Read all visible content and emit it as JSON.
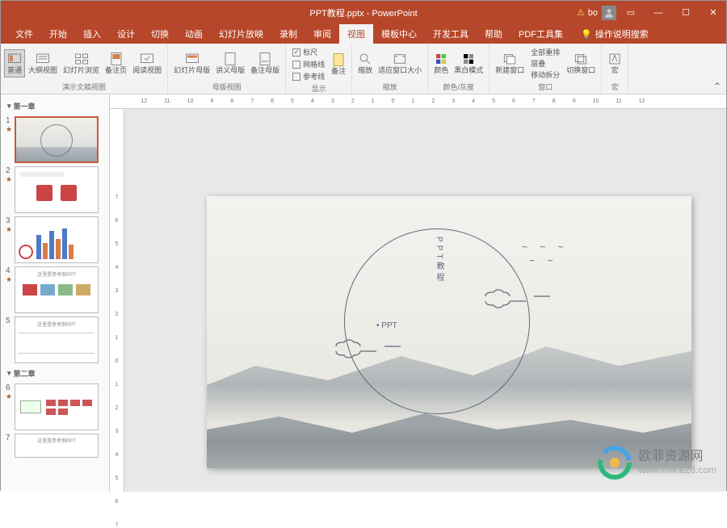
{
  "titlebar": {
    "title": "PPT教程.pptx - PowerPoint",
    "warn_icon": "⚠",
    "user": "bo"
  },
  "menu": {
    "items": [
      "文件",
      "开始",
      "插入",
      "设计",
      "切换",
      "动画",
      "幻灯片放映",
      "录制",
      "审阅",
      "视图",
      "模板中心",
      "开发工具",
      "帮助",
      "PDF工具集"
    ],
    "active_index": 9,
    "tell_me": "操作说明搜索"
  },
  "ribbon": {
    "presentation_views": {
      "label": "演示文稿视图",
      "normal": "普通",
      "outline": "大纲视图",
      "sorter": "幻灯片浏览",
      "notes_page": "备注页",
      "reading": "阅读视图"
    },
    "master_views": {
      "label": "母版视图",
      "slide_master": "幻灯片母版",
      "handout_master": "讲义母版",
      "notes_master": "备注母版"
    },
    "show": {
      "label": "显示",
      "ruler": "标尺",
      "gridlines": "网格线",
      "guides": "参考线",
      "notes": "备注"
    },
    "zoom": {
      "label": "缩放",
      "zoom": "缩放",
      "fit": "适应窗口大小"
    },
    "color": {
      "label": "颜色/灰度",
      "color": "颜色",
      "bw": "黑白模式"
    },
    "window": {
      "label": "窗口",
      "new": "新建窗口",
      "arrange": "全部重排",
      "cascade": "层叠",
      "split": "移动拆分",
      "switch": "切换窗口"
    },
    "macros": {
      "label": "宏",
      "macros": "宏"
    }
  },
  "sections": {
    "section1": "第一章",
    "section2": "第二章"
  },
  "slide": {
    "vertical_text": "PPT教程",
    "bullet_text": "• PPT"
  },
  "ruler": {
    "h": [
      "12",
      "11",
      "10",
      "9",
      "8",
      "7",
      "6",
      "5",
      "4",
      "3",
      "2",
      "1",
      "0",
      "1",
      "2",
      "3",
      "4",
      "5",
      "6",
      "7",
      "8",
      "9",
      "10",
      "11",
      "12"
    ],
    "v": [
      "7",
      "6",
      "5",
      "4",
      "3",
      "2",
      "1",
      "0",
      "1",
      "2",
      "3",
      "4",
      "5",
      "6",
      "7"
    ]
  },
  "watermark": {
    "line1": "欧菲资源网",
    "line2": "www.office26.com"
  },
  "thumbs": {
    "t4_title": "这里是参考例PPT",
    "t5_title": "这里是参考例PPT",
    "t7_title": "这里是参考例PPT"
  }
}
